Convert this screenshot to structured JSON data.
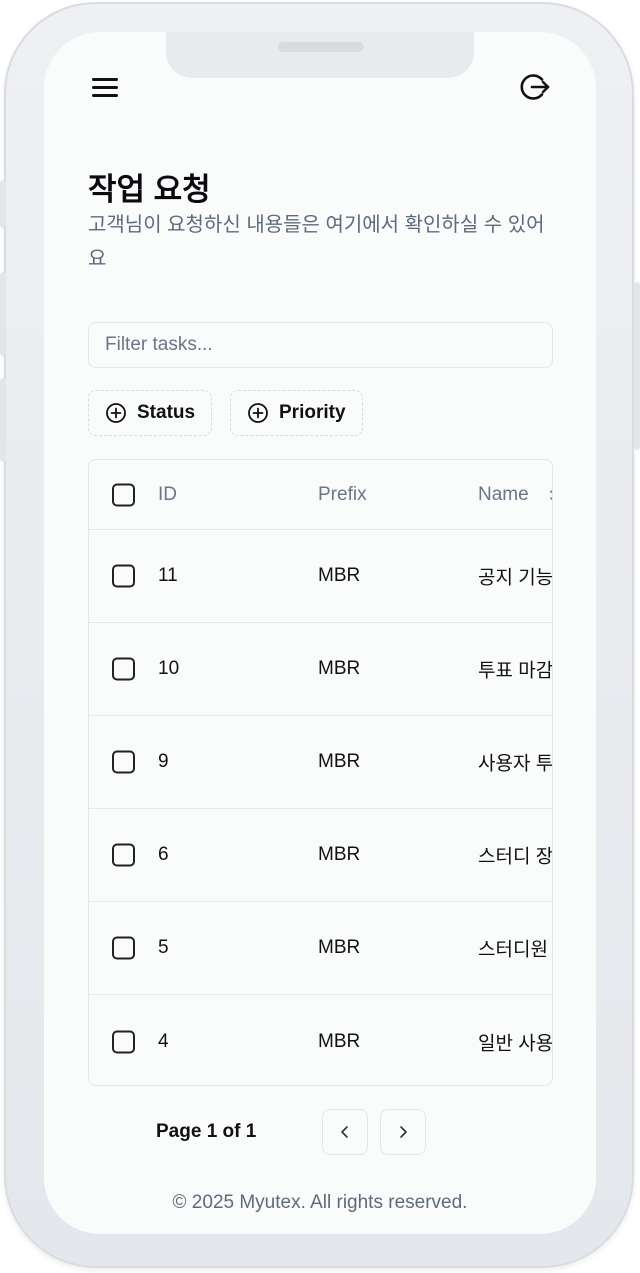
{
  "header": {
    "menu_icon": "hamburger-menu-icon",
    "logout_icon": "logout-icon"
  },
  "page": {
    "title": "작업 요청",
    "subtitle": "고객님이 요청하신 내용들은 여기에서 확인하실 수 있어요"
  },
  "filter": {
    "placeholder": "Filter tasks...",
    "value": ""
  },
  "filters": [
    {
      "label": "Status",
      "icon": "plus-circle-icon"
    },
    {
      "label": "Priority",
      "icon": "plus-circle-icon"
    }
  ],
  "table": {
    "columns": [
      "ID",
      "Prefix",
      "Name"
    ],
    "rows": [
      {
        "id": "11",
        "prefix": "MBR",
        "name": "공지 기능"
      },
      {
        "id": "10",
        "prefix": "MBR",
        "name": "투표 마감"
      },
      {
        "id": "9",
        "prefix": "MBR",
        "name": "사용자 투"
      },
      {
        "id": "6",
        "prefix": "MBR",
        "name": "스터디 장"
      },
      {
        "id": "5",
        "prefix": "MBR",
        "name": "스터디원"
      },
      {
        "id": "4",
        "prefix": "MBR",
        "name": "일반 사용"
      }
    ]
  },
  "pagination": {
    "label": "Page 1 of 1"
  },
  "footer": {
    "text": "© 2025 Myutex. All rights reserved."
  }
}
